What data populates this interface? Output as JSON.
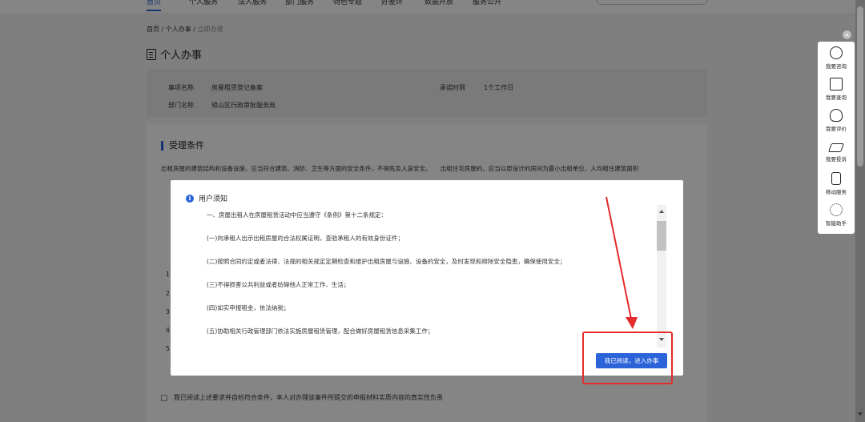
{
  "nav": {
    "items": [
      "首页",
      "个人服务",
      "法人服务",
      "部门服务",
      "特色专题",
      "好差评",
      "数据开放",
      "服务公开"
    ],
    "search_placeholder": "搜索"
  },
  "breadcrumb": {
    "home": "首页",
    "sep": "/",
    "personal": "个人办事",
    "current": "立即办理"
  },
  "page_title": "个人办事",
  "info": {
    "item_name_label": "事项名称",
    "item_name_value": "房屋租赁登记备案",
    "promise_label": "承诺时限",
    "promise_value": "1个工作日",
    "dept_label": "部门名称",
    "dept_value": "琅山区行政审批服务局"
  },
  "conditions": {
    "title": "受理条件",
    "line1": "出租房屋的建筑结构和设备设施，应当符合建筑、消防、卫生等方面的安全条件，不得危及人身安全。　　出租住宅房屋的，应当以原设计的房间为最小出租单位，人均租住建筑面积"
  },
  "row_numbers": [
    "1",
    "2",
    "3",
    "4",
    "5"
  ],
  "agree_text": "我已阅读上述要求并自检符合条件，本人对办理该事件所提交的申报材料实质内容的真实性负责",
  "float_toolbar": {
    "close": "×",
    "items": [
      "我要咨询",
      "我要查询",
      "我要评价",
      "我要投诉",
      "移动服务",
      "智能助手"
    ]
  },
  "modal": {
    "title": "用户须知",
    "info_glyph": "i",
    "paragraphs": [
      "一、房屋出租人在房屋租赁活动中应当遵守《条例》第十二条规定：",
      "(一)向承租人出示出租房屋的合法权属证明，查验承租人的有效身份证件；",
      "(二)按照合同约定或者法律、法规的相关规定定期检查和维护出租房屋与设施、设备的安全，及时发现和排除安全隐患，确保使用安全；",
      "(三)不得损害公共利益或者妨碍他人正常工作、生活；",
      "(四)如实申报租金，依法纳税；",
      "(五)协助相关行政管理部门依法实施房屋租赁管理，配合做好房屋租赁信息采集工作；"
    ],
    "confirm_button": "我已阅读，进入办事"
  },
  "colors": {
    "accent": "#2b63d9",
    "annotation": "#e52b2b"
  }
}
